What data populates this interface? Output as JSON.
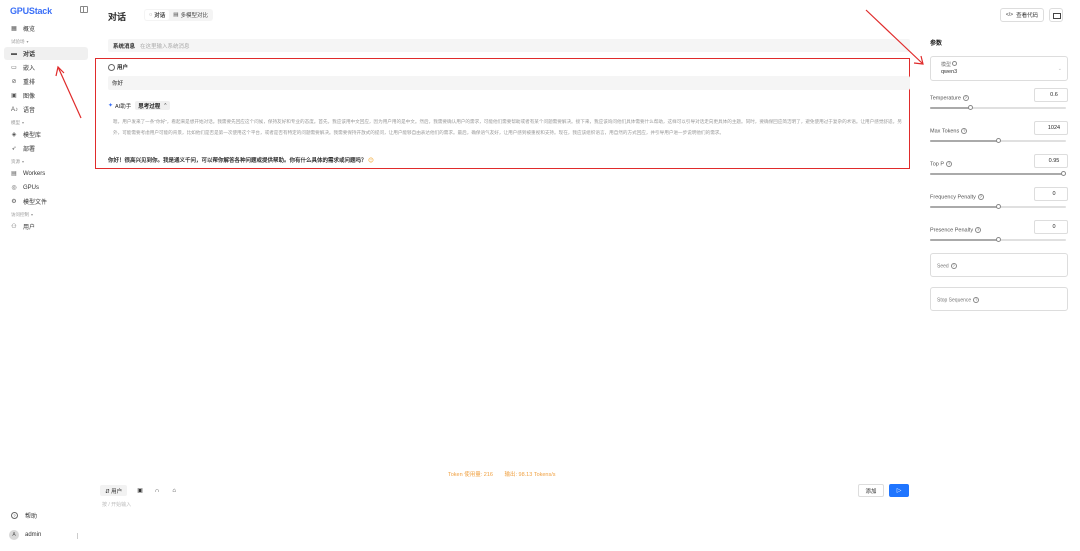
{
  "app": {
    "logo": "GPUStack"
  },
  "sidebar": {
    "items": [
      {
        "label": "概览",
        "icon": "grid-icon",
        "glyph": "▦"
      },
      {
        "group": "试验场"
      },
      {
        "label": "对话",
        "icon": "chat-icon",
        "glyph": "▬",
        "active": true
      },
      {
        "label": "嵌入",
        "icon": "embed-icon",
        "glyph": "▭"
      },
      {
        "label": "重排",
        "icon": "rerank-icon",
        "glyph": "⊘"
      },
      {
        "label": "图像",
        "icon": "image-icon",
        "glyph": "▣"
      },
      {
        "label": "语音",
        "icon": "voice-icon",
        "glyph": "A♪"
      },
      {
        "group": "模型"
      },
      {
        "label": "模型库",
        "icon": "cube-icon",
        "glyph": "◈"
      },
      {
        "label": "部署",
        "icon": "rocket-icon",
        "glyph": "➶"
      },
      {
        "group": "资源"
      },
      {
        "label": "Workers",
        "icon": "server-icon",
        "glyph": "▤"
      },
      {
        "label": "GPUs",
        "icon": "gpu-icon",
        "glyph": "◎"
      },
      {
        "label": "模型文件",
        "icon": "file-icon",
        "glyph": "⚙"
      },
      {
        "group": "访问控制"
      },
      {
        "label": "用户",
        "icon": "users-icon",
        "glyph": "⚇"
      }
    ],
    "help": "帮助",
    "user": {
      "avatar_letter": "A",
      "name": "admin"
    }
  },
  "header": {
    "title": "对话",
    "tabs": [
      {
        "label": "对话",
        "active": true
      },
      {
        "label": "多模型对比",
        "active": false
      }
    ],
    "view_code": "查看代码"
  },
  "chat": {
    "system_label": "系统消息",
    "system_placeholder": "在这里输入系统消息",
    "user_role": "用户",
    "user_message": "你好",
    "ai_role": "AI助手",
    "thinking_label": "思考过程",
    "thinking_text": "嗯，用户发来了一条\"你好\"，看起来是想开始对话。我需要先回应这个问候，保持友好和专业的态度。首先，我应该用中文回应，因为用户用的是中文。然后，我需要确认用户的需求，可能他们需要帮助或者有某个问题需要解决。接下来，我应该询问他们具体需要什么帮助，这样可以引导对话走向更具体的主题。同时，要确保回应简洁明了，避免使用过于复杂的术语。让用户感觉舒适。另外，可能需要考虑用户可能的背景，比如他们是否是第一次使用这个平台，或者是否有特定的问题需要解决。我需要保持开放式的提问，让用户能够自由表达他们的需求。最后，确保语气友好，让用户感到被重视和支持。现在，我应该组织语言，用自然的方式回应，并引导用户进一步说明他们的需求。",
    "answer": "你好！很高兴见到你。我是通义千问，可以帮你解答各种问题或提供帮助。你有什么具体的需求或问题吗？",
    "answer_emoji": "😊"
  },
  "footer": {
    "token_usage": "Token 使用量: 216",
    "output_speed": "输出: 98.13 Tokens/s",
    "role_switch": "⇵ 用户",
    "add_label": "添加",
    "send_glyph": "▷",
    "input_placeholder": "按 / 开始输入"
  },
  "params": {
    "title": "参数",
    "model_label": "模型",
    "model_value": "qwen3",
    "sliders": [
      {
        "label": "Temperature",
        "value": "0.6",
        "fraction": 0.3
      },
      {
        "label": "Max Tokens",
        "value": "1024",
        "fraction": 0.5
      },
      {
        "label": "Top P",
        "value": "0.95",
        "fraction": 0.98
      },
      {
        "label": "Frequency Penalty",
        "value": "0",
        "fraction": 0.5
      },
      {
        "label": "Presence Penalty",
        "value": "0",
        "fraction": 0.5
      }
    ],
    "seed_label": "Seed",
    "stop_label": "Stop Sequence"
  },
  "colors": {
    "accent": "#1f75ff",
    "annotation": "#e02b2b",
    "token": "#f0a040"
  }
}
